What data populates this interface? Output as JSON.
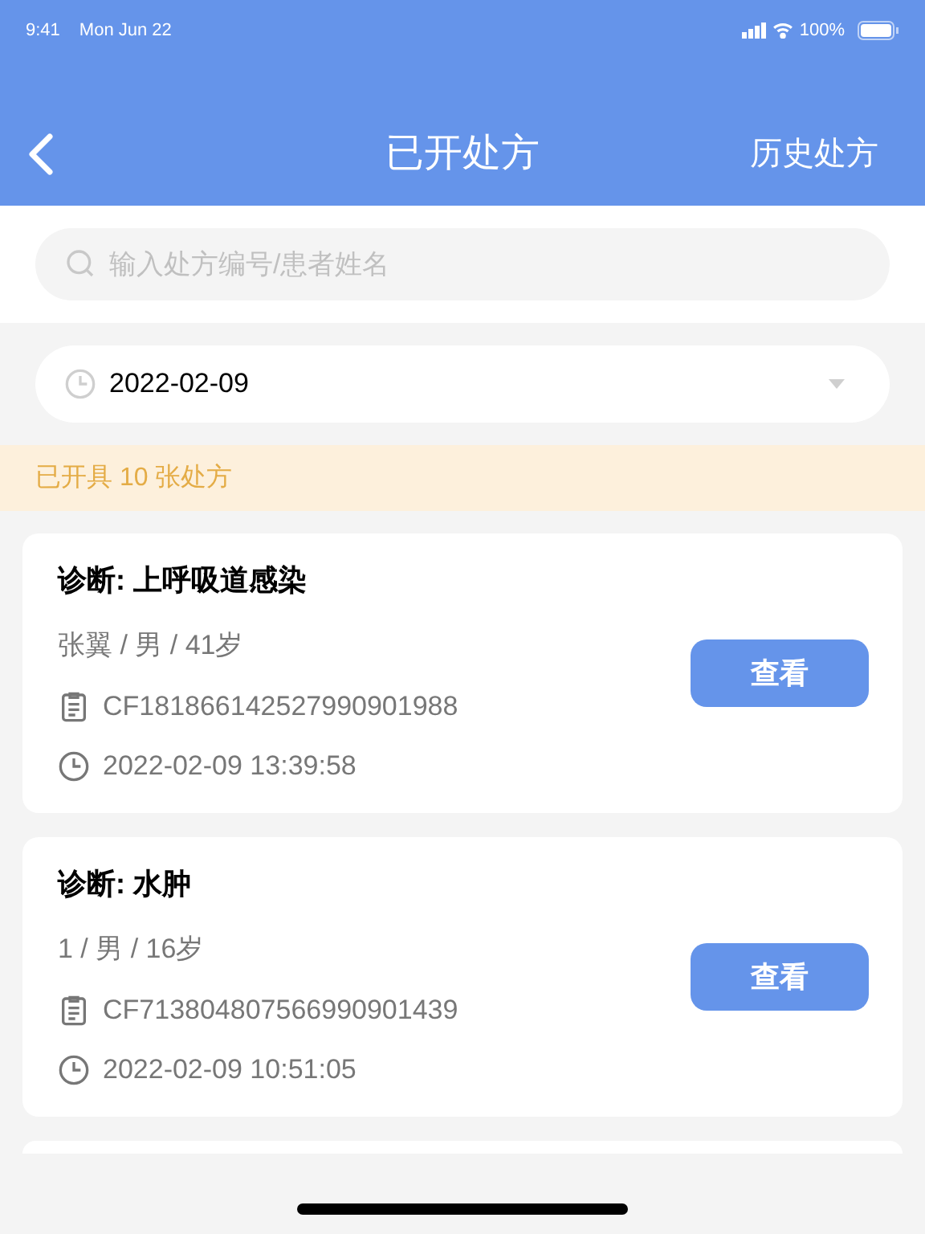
{
  "status_bar": {
    "time": "9:41",
    "date": "Mon Jun 22",
    "battery": "100%"
  },
  "nav": {
    "title": "已开处方",
    "action": "历史处方"
  },
  "search": {
    "placeholder": "输入处方编号/患者姓名"
  },
  "date_picker": {
    "value": "2022-02-09"
  },
  "summary": "已开具 10 张处方",
  "prescriptions": [
    {
      "diagnosis": "诊断: 上呼吸道感染",
      "patient": "张翼 / 男 / 41岁",
      "number": "CF181866142527990901988",
      "time": "2022-02-09 13:39:58",
      "button": "查看"
    },
    {
      "diagnosis": "诊断: 水肿",
      "patient": "1 / 男 / 16岁",
      "number": "CF713804807566990901439",
      "time": "2022-02-09 10:51:05",
      "button": "查看"
    }
  ]
}
